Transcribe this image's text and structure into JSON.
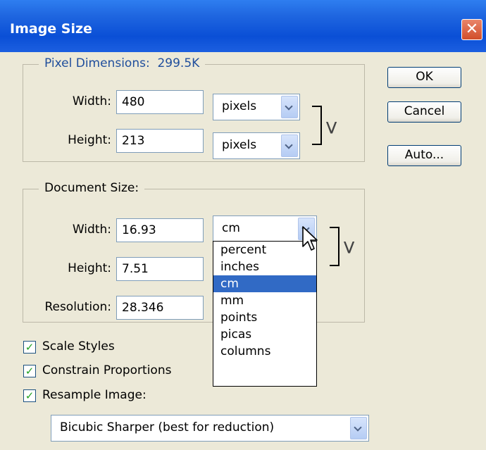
{
  "window": {
    "title": "Image Size",
    "close_glyph": "✕"
  },
  "pixel_dimensions": {
    "legend": "Pixel Dimensions:",
    "size": "299.5K",
    "width_label": "Width:",
    "width_value": "480",
    "width_unit": "pixels",
    "height_label": "Height:",
    "height_value": "213",
    "height_unit": "pixels"
  },
  "document_size": {
    "legend": "Document Size:",
    "width_label": "Width:",
    "width_value": "16.93",
    "width_unit": "cm",
    "height_label": "Height:",
    "height_value": "7.51",
    "resolution_label": "Resolution:",
    "resolution_value": "28.346"
  },
  "unit_dropdown": {
    "options": [
      "percent",
      "inches",
      "cm",
      "mm",
      "points",
      "picas",
      "columns"
    ],
    "selected": "cm"
  },
  "buttons": {
    "ok": "OK",
    "cancel": "Cancel",
    "auto": "Auto..."
  },
  "checkboxes": {
    "scale_styles": {
      "label": "Scale Styles",
      "checked": true
    },
    "constrain_proportions": {
      "label": "Constrain Proportions",
      "checked": true
    },
    "resample_image": {
      "label": "Resample Image:",
      "checked": true
    }
  },
  "resample_method": "Bicubic Sharper (best for reduction)",
  "colors": {
    "titlebar": "#0a4fd6",
    "selection": "#316ac5",
    "dialog_bg": "#ece9d8"
  }
}
